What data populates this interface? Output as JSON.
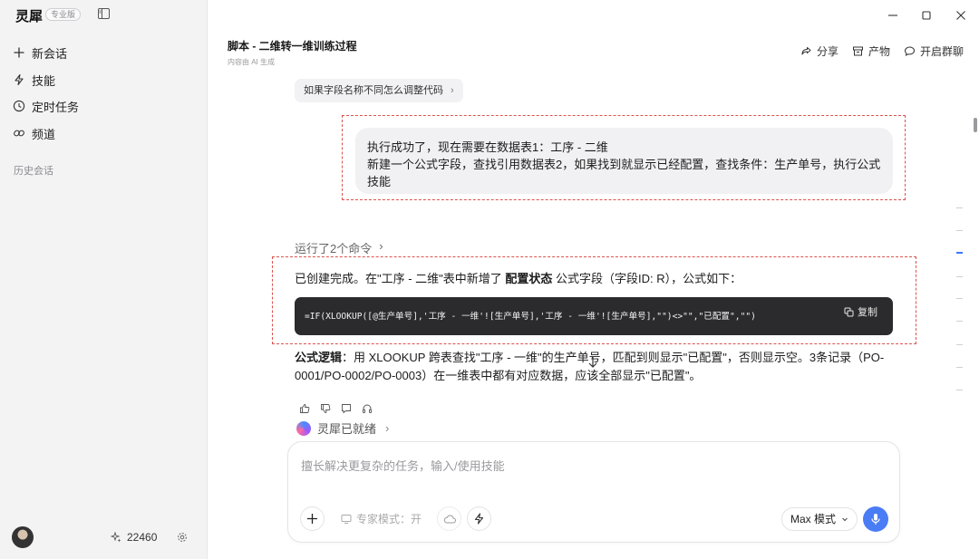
{
  "sidebar": {
    "brand": "灵犀",
    "badge": "专业版",
    "items": [
      {
        "label": "新会话",
        "icon": "plus-icon"
      },
      {
        "label": "技能",
        "icon": "bolt-icon"
      },
      {
        "label": "定时任务",
        "icon": "clock-icon"
      },
      {
        "label": "频道",
        "icon": "link-icon"
      }
    ],
    "history_label": "历史会话",
    "credits": "22460"
  },
  "header": {
    "title": "脚本 - 二维转一维训练过程",
    "subtitle": "内容由 AI 生成",
    "share": "分享",
    "artifacts": "产物",
    "group_chat": "开启群聊"
  },
  "chat": {
    "suggestion": "如果字段名称不同怎么调整代码",
    "user_message_line1": "执行成功了，现在需要在数据表1：工序 - 二维",
    "user_message_line2": "新建一个公式字段，查找引用数据表2，如果找到就显示已经配置，查找条件：生产单号，执行公式技能",
    "commands_run": "运行了2个命令",
    "reply_pre": "已创建完成。在\"工序 - 二维\"表中新增了 ",
    "reply_bold": "配置状态",
    "reply_post": " 公式字段（字段ID: R），公式如下：",
    "code": "=IF(XLOOKUP([@生产单号],'工序 - 一维'![生产单号],'工序 - 一维'![生产单号],\"\")<>\"\",\"已配置\",\"\")",
    "copy_label": "复制",
    "logic_bold": "公式逻辑",
    "logic_text": "：用 XLOOKUP 跨表查找\"工序 - 一维\"的生产单号，匹配到则显示\"已配置\"，否则显示空。3条记录（PO-0001/PO-0002/PO-0003）在一维表中都有对应数据，应该全部显示\"已配置\"。",
    "status": "灵犀已就绪"
  },
  "composer": {
    "placeholder": "擅长解决更复杂的任务，输入/使用技能",
    "expert_mode": "专家模式：开",
    "model": "Max 模式"
  },
  "colors": {
    "accent": "#4a7cf5",
    "annotation": "#d9534f",
    "code_bg": "#2b2b2d"
  }
}
